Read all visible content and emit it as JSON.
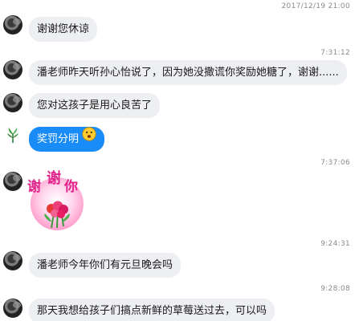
{
  "messages": [
    {
      "text": "谢谢您休谅"
    },
    {
      "text": "潘老师昨天听孙心怡说了，因为她没撒谎你奖励她糖了，谢谢......"
    },
    {
      "text": "您对这孩子是用心良苦了"
    },
    {
      "text": "奖罚分明"
    },
    {
      "text": "潘老师今年你们有元旦晚会吗"
    },
    {
      "text": "那天我想给孩子们搞点新鲜的草莓送过去，可以吗"
    }
  ],
  "timestamps": {
    "t0": "2017/12/19 21:00",
    "t1": "7:31:12",
    "t2": "7:37:06",
    "t3": "9:24:31",
    "t4": "9:28:08"
  },
  "sticker": {
    "char1": "谢",
    "char2": "谢",
    "char3": "你"
  },
  "icons": {
    "emoji": "smiley-face-icon",
    "sticker": "thank-you-flower-sticker-icon"
  },
  "colors": {
    "bubble_gray": "#eeeff2",
    "bubble_blue": "#1a8cf7",
    "timestamp": "#8a8a8a"
  }
}
